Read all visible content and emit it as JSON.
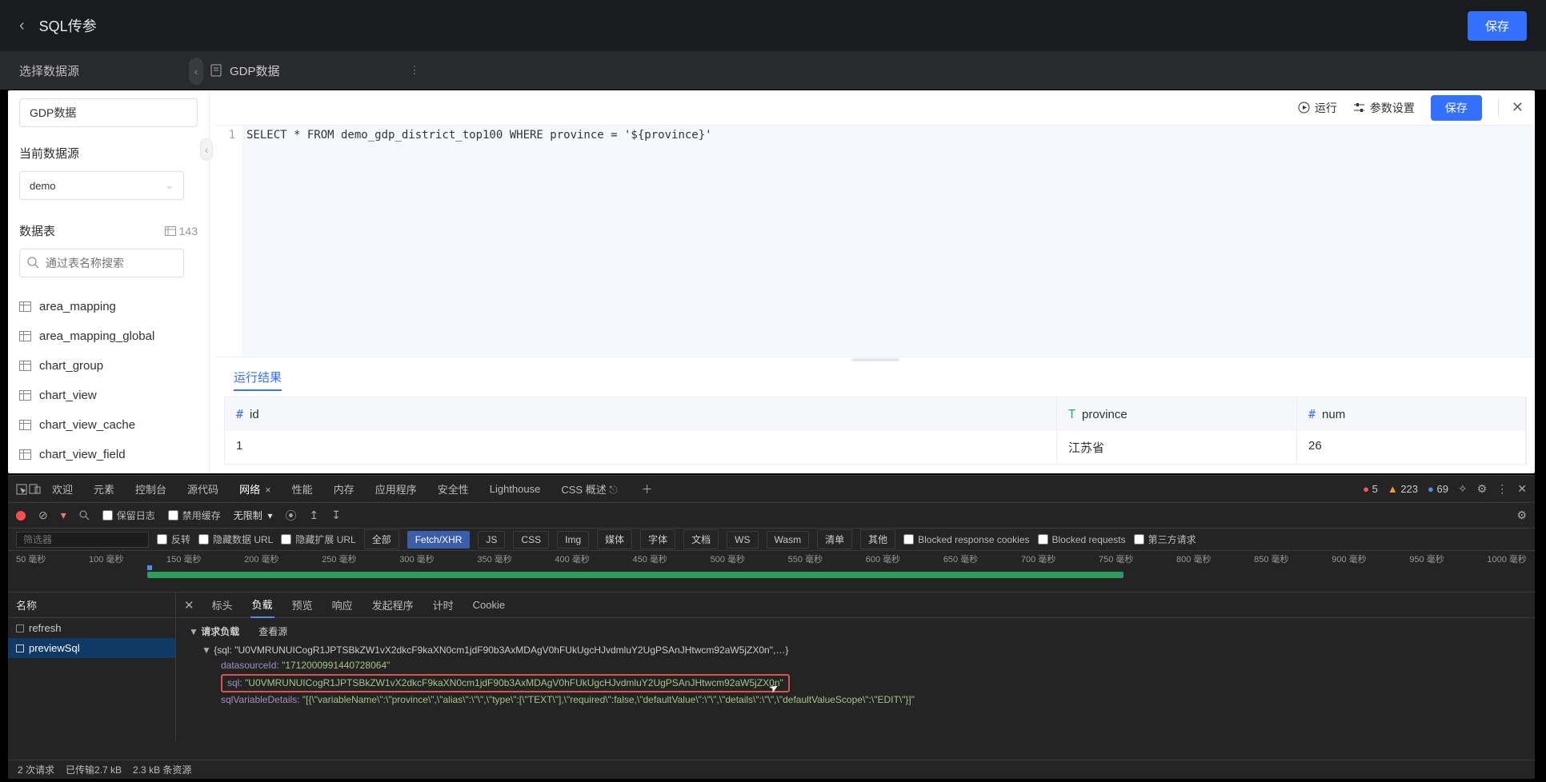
{
  "header": {
    "title": "SQL传参",
    "save": "保存"
  },
  "sub": {
    "selectDs": "选择数据源",
    "docName": "GDP数据"
  },
  "panel": {
    "nameInput": "GDP数据",
    "currentDsLabel": "当前数据源",
    "currentDs": "demo",
    "tablesLabel": "数据表",
    "tablesCount": "143",
    "searchPlaceholder": "通过表名称搜索",
    "tables": [
      "area_mapping",
      "area_mapping_global",
      "chart_group",
      "chart_view",
      "chart_view_cache",
      "chart_view_field"
    ],
    "toolbar": {
      "run": "运行",
      "params": "参数设置",
      "save": "保存"
    },
    "sql": "SELECT * FROM demo_gdp_district_top100 WHERE province = '${province}'",
    "resultTab": "运行结果",
    "columns": {
      "id": "id",
      "province": "province",
      "num": "num"
    },
    "row": {
      "id": "1",
      "province": "江苏省",
      "num": "26"
    }
  },
  "dev": {
    "tabs": [
      "欢迎",
      "元素",
      "控制台",
      "源代码",
      "网络",
      "性能",
      "内存",
      "应用程序",
      "安全性",
      "Lighthouse",
      "CSS 概述"
    ],
    "activeTab": "网络",
    "errors": "5",
    "warns": "223",
    "infos": "69",
    "toolbar": {
      "keepLog": "保留日志",
      "disableCache": "禁用缓存",
      "unlimited": "无限制"
    },
    "filterPlaceholder": "筛选器",
    "filterChecks": [
      "反转",
      "隐藏数据 URL",
      "隐藏扩展 URL"
    ],
    "filterBtns": [
      "全部",
      "Fetch/XHR",
      "JS",
      "CSS",
      "Img",
      "媒体",
      "字体",
      "文档",
      "WS",
      "Wasm",
      "清单",
      "其他"
    ],
    "filterChecks2": [
      "Blocked response cookies",
      "Blocked requests",
      "第三方请求"
    ],
    "timelineLabels": [
      "50 毫秒",
      "100 毫秒",
      "150 毫秒",
      "200 毫秒",
      "250 毫秒",
      "300 毫秒",
      "350 毫秒",
      "400 毫秒",
      "450 毫秒",
      "500 毫秒",
      "550 毫秒",
      "600 毫秒",
      "650 毫秒",
      "700 毫秒",
      "750 毫秒",
      "800 毫秒",
      "850 毫秒",
      "900 毫秒",
      "950 毫秒",
      "1000 毫秒"
    ],
    "namesHeader": "名称",
    "names": [
      "refresh",
      "previewSql"
    ],
    "detailTabs": [
      "标头",
      "负载",
      "预览",
      "响应",
      "发起程序",
      "计时",
      "Cookie"
    ],
    "activeDetailTab": "负载",
    "payload": {
      "headLabel": "请求负载",
      "viewSource": "查看源",
      "root": "{sql: \"U0VMRUNUICogR1JPTSBkZW1vX2dkcF9kaXN0cm1jdF90b3AxMDAgV0hFUkUgcHJvdmluY2UgPSAnJHtwcm92aW5jZX0n\",…}",
      "dsKey": "datasourceId:",
      "dsVal": "\"1712000991440728064\"",
      "sqlKey": "sql:",
      "sqlVal": "\"U0VMRUNUICogR1JPTSBkZW1vX2dkcF9kaXN0cm1jdF90b3AxMDAgV0hFUkUgcHJvdmluY2UgPSAnJHtwcm92aW5jZX0n\"",
      "varKey": "sqlVariableDetails:",
      "varVal": "\"[{\\\"variableName\\\":\\\"province\\\",\\\"alias\\\":\\\"\\\",\\\"type\\\":[\\\"TEXT\\\"],\\\"required\\\":false,\\\"defaultValue\\\":\\\"\\\",\\\"details\\\":\\\"\\\",\\\"defaultValueScope\\\":\\\"EDIT\\\"}]\""
    },
    "status": {
      "reqs": "2 次请求",
      "transfer": "已传输2.7 kB",
      "resources": "2.3 kB 条资源"
    }
  }
}
